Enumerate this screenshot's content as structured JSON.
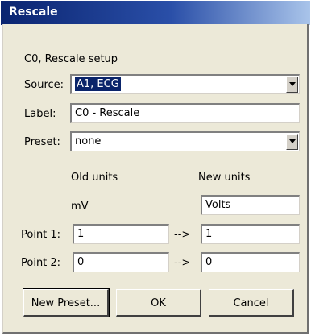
{
  "window": {
    "title": "Rescale"
  },
  "header": {
    "text": "C0, Rescale setup"
  },
  "source": {
    "label": "Source:",
    "value": "A1, ECG"
  },
  "label_field": {
    "label": "Label:",
    "value": "C0 - Rescale"
  },
  "preset": {
    "label": "Preset:",
    "value": "none"
  },
  "units": {
    "old_header": "Old units",
    "new_header": "New units",
    "old_value": "mV",
    "new_value": "Volts"
  },
  "points": [
    {
      "label": "Point 1:",
      "old": "1",
      "arrow": "-->",
      "new": "1"
    },
    {
      "label": "Point 2:",
      "old": "0",
      "arrow": "-->",
      "new": "0"
    }
  ],
  "buttons": {
    "new_preset": "New Preset...",
    "ok": "OK",
    "cancel": "Cancel"
  },
  "icons": {
    "dropdown": "chevron-down-icon"
  }
}
